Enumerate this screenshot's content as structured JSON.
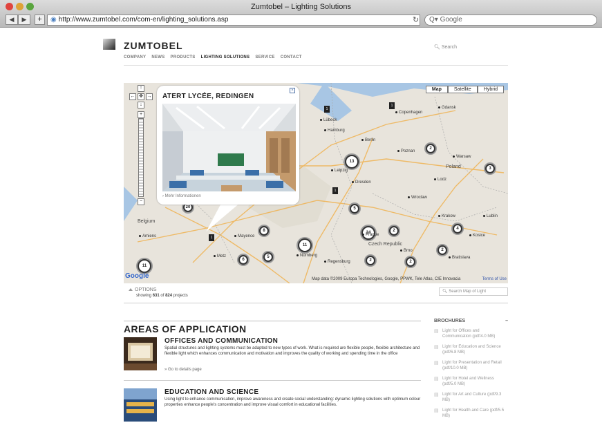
{
  "browser": {
    "window_title": "Zumtobel – Lighting Solutions",
    "url": "http://www.zumtobel.com/com-en/lighting_solutions.asp",
    "search_placeholder": "Google",
    "back_icon": "back-arrow-icon",
    "forward_icon": "forward-arrow-icon"
  },
  "site": {
    "logo": "ZUMTOBEL",
    "nav": [
      "COMPANY",
      "NEWS",
      "PRODUCTS",
      "LIGHTING SOLUTIONS",
      "SERVICE",
      "CONTACT"
    ],
    "active_nav": "LIGHTING SOLUTIONS",
    "search_placeholder": "Search"
  },
  "map": {
    "types": [
      "Map",
      "Satellite",
      "Hybrid"
    ],
    "selected_type": "Map",
    "popup": {
      "title": "ATERT LYCÉE, REDINGEN",
      "more_link": "Mehr Informationen"
    },
    "clusters": [
      "20",
      "13",
      "5",
      "8",
      "24",
      "2",
      "2",
      "2",
      "4",
      "2",
      "3",
      "11",
      "6",
      "5",
      "11",
      "2"
    ],
    "cities": [
      "Copenhagen",
      "Gdansk",
      "Lübeck",
      "Hamburg",
      "Berlin",
      "Poznan",
      "Warsaw",
      "Poland",
      "Wroclaw",
      "Lodz",
      "Leipzig",
      "Dresden",
      "Czech Republic",
      "Prague",
      "Krakow",
      "Belgium",
      "Amiens",
      "Mayence",
      "Nürnberg",
      "Metz",
      "Regensburg",
      "Brno",
      "Bratislava",
      "Kosice",
      "Lublin"
    ],
    "attribution": "Map data ©2009 Europa Technologies, Google, PPWK, Tele Atlas, CIE Innovacia",
    "terms": "Terms of Use",
    "google": "Google"
  },
  "options": {
    "label": "OPTIONS",
    "showing_prefix": "showing",
    "shown": "631",
    "of_word": "of",
    "total": "824",
    "suffix": "projects",
    "map_search_placeholder": "Search Map of Light"
  },
  "areas": {
    "title": "AREAS OF APPLICATION",
    "items": [
      {
        "title": "OFFICES AND COMMUNICATION",
        "description": "Spatial structures and lighting systems must be adapted to new types of work. What is required are flexible people, flexible architecture and flexible light which enhances communication and motivation and improves the quality of working and spending time in the office",
        "link": "» Go to details page"
      },
      {
        "title": "EDUCATION AND SCIENCE",
        "description": "Using light to enhance communication, improve awareness and create social understanding: dynamic lighting solutions with optimum colour properties enhance people's concentration and improve visual comfort in educational facilities.",
        "link": ""
      }
    ]
  },
  "brochures": {
    "title": "BROCHURES",
    "collapse": "–",
    "items": [
      "Light for Offices and Communication (pdf/4.0 MB)",
      "Light for Education and Science (pdf/6.8 MB)",
      "Light for Presentation and Retail (pdf/10.0 MB)",
      "Light for Hotel and Wellness (pdf/5.0 MB)",
      "Light for Art and Culture (pdf/9.3 MB)",
      "Light for Health and Care (pdf/5.5 MB)"
    ]
  },
  "colors": {
    "map_land": "#e8e4dc",
    "map_water": "#a8c6e4",
    "road": "#f0b04a",
    "link_blue": "#3355aa"
  }
}
